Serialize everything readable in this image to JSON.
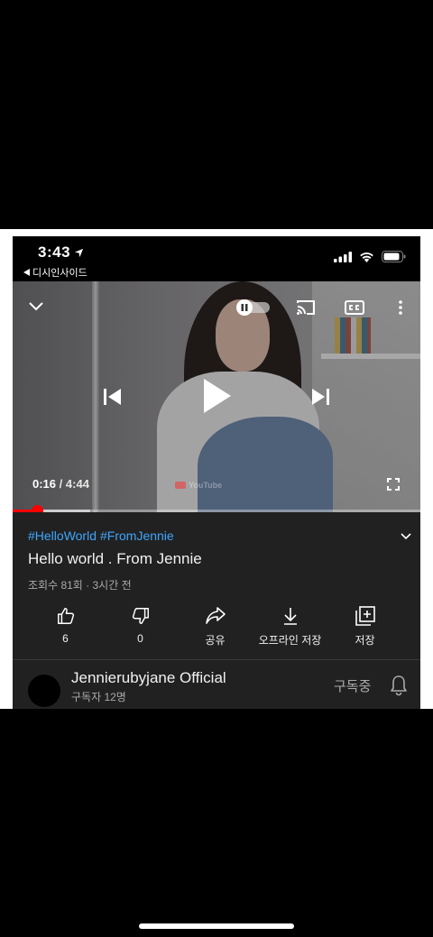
{
  "status_bar": {
    "time": "3:43",
    "back_app": "디시인사이드"
  },
  "player": {
    "current_time": "0:16",
    "separator": "/",
    "duration": "4:44",
    "watermark": "YouTube",
    "progress_fraction": 0.057,
    "buffer_fraction": 0.19
  },
  "video": {
    "hashtags": [
      "#HelloWorld",
      "#FromJennie"
    ],
    "title": "Hello world . From Jennie",
    "meta": "조회수 81회 · 3시간 전"
  },
  "actions": [
    {
      "label": "6",
      "icon": "thumbs-up-icon"
    },
    {
      "label": "0",
      "icon": "thumbs-down-icon"
    },
    {
      "label": "공유",
      "icon": "share-icon"
    },
    {
      "label": "오프라인 저장",
      "icon": "download-icon"
    },
    {
      "label": "저장",
      "icon": "add-to-playlist-icon"
    }
  ],
  "channel": {
    "name": "Jennierubyjane Official",
    "subscribers": "구독자 12명",
    "subscribe_state": "구독중"
  },
  "colors": {
    "accent_red": "#ff0000",
    "link_blue": "#3ea6ff",
    "panel_bg": "#212121",
    "secondary_text": "#aaaaaa"
  }
}
